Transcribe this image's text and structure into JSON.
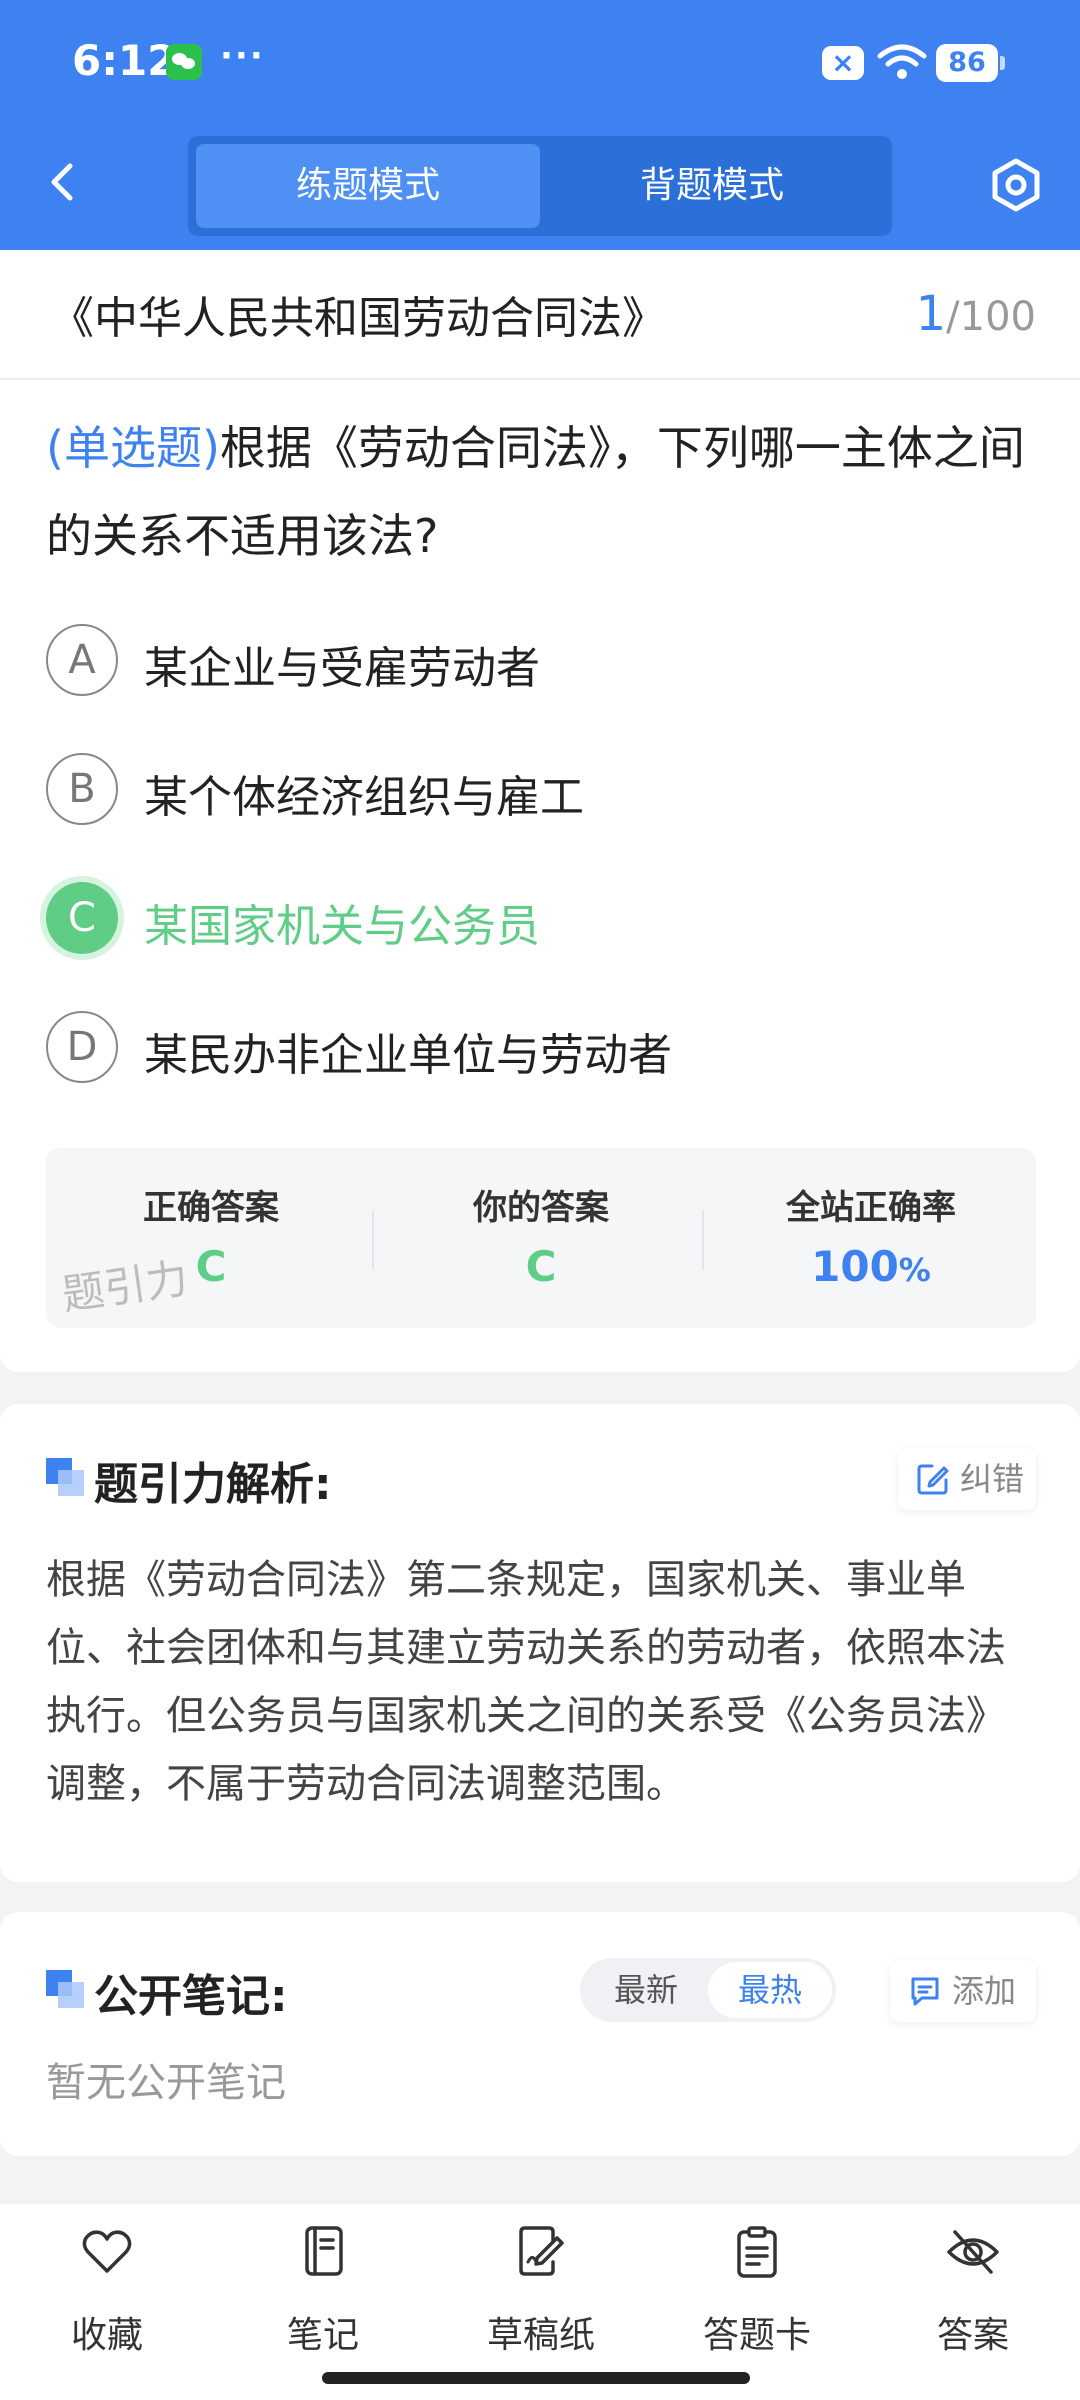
{
  "status_bar": {
    "time": "6:12",
    "dots": "···",
    "sim_label": "×",
    "battery": "86"
  },
  "header": {
    "tabs": [
      {
        "label": "练题模式",
        "active": true
      },
      {
        "label": "背题模式",
        "active": false
      }
    ],
    "back_icon": "back-arrow-icon",
    "settings_icon": "settings-hex-icon"
  },
  "question_set": {
    "title": "《中华人民共和国劳动合同法》",
    "current": "1",
    "total": "/100"
  },
  "question": {
    "type_label": "(单选题)",
    "text": "根据《劳动合同法》，下列哪一主体之间的关系不适用该法?",
    "options": [
      {
        "letter": "A",
        "text": "某企业与受雇劳动者",
        "state": "normal"
      },
      {
        "letter": "B",
        "text": "某个体经济组织与雇工",
        "state": "normal"
      },
      {
        "letter": "C",
        "text": "某国家机关与公务员",
        "state": "correct"
      },
      {
        "letter": "D",
        "text": "某民办非企业单位与劳动者",
        "state": "normal"
      }
    ]
  },
  "result": {
    "correct_label": "正确答案",
    "correct_value": "C",
    "yours_label": "你的答案",
    "yours_value": "C",
    "rate_label": "全站正确率",
    "rate_value": "100",
    "rate_unit": "%",
    "watermark": "题引力"
  },
  "analysis": {
    "title": "题引力解析:",
    "report_label": "纠错",
    "text": "根据《劳动合同法》第二条规定，国家机关、事业单位、社会团体和与其建立劳动关系的劳动者，依照本法执行。但公务员与国家机关之间的关系受《公务员法》调整，不属于劳动合同法调整范围。"
  },
  "notes": {
    "title": "公开笔记:",
    "sort_latest": "最新",
    "sort_hot": "最热",
    "add_label": "添加",
    "empty_text": "暂无公开笔记"
  },
  "bottom_bar": [
    {
      "label": "收藏",
      "icon": "heart-icon"
    },
    {
      "label": "笔记",
      "icon": "notebook-icon"
    },
    {
      "label": "草稿纸",
      "icon": "draft-edit-icon"
    },
    {
      "label": "答题卡",
      "icon": "clipboard-icon"
    },
    {
      "label": "答案",
      "icon": "eye-off-icon"
    }
  ],
  "colors": {
    "primary": "#3d82f0",
    "correct": "#5fcd86",
    "background": "#f2f3f5"
  }
}
